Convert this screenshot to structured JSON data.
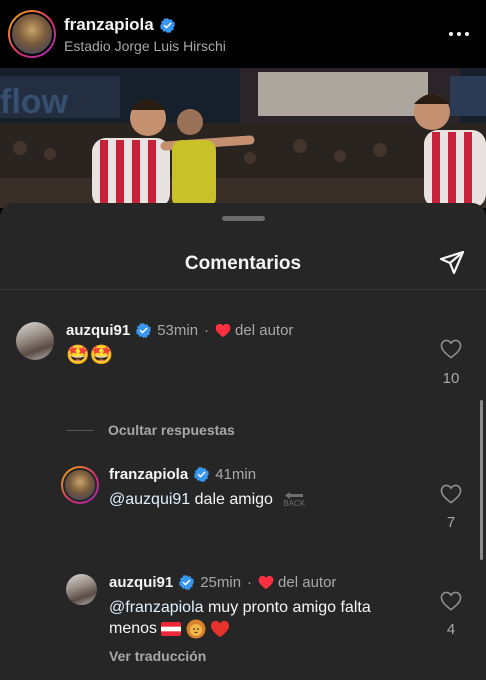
{
  "post": {
    "username": "franzapiola",
    "location": "Estadio Jorge Luis Hirschi"
  },
  "sheet": {
    "title": "Comentarios"
  },
  "comments": [
    {
      "username": "auzqui91",
      "time": "53min",
      "author_like": "del autor",
      "emoji_text": "🤩🤩",
      "likes": "10"
    }
  ],
  "hide_replies": "Ocultar respuestas",
  "replies": [
    {
      "username": "franzapiola",
      "time": "41min",
      "mention": "@auzqui91",
      "text": "dale amigo",
      "likes": "7",
      "back_badge": "BACK"
    },
    {
      "username": "auzqui91",
      "time": "25min",
      "author_like": "del autor",
      "mention": "@franzapiola",
      "text_line1": "muy pronto amigo falta",
      "text_line2": "menos",
      "likes": "4",
      "translate": "Ver traducción"
    }
  ],
  "icons": {
    "verified": "verified-badge-icon",
    "heart_filled": "heart-filled-icon",
    "heart_outline": "heart-outline-icon",
    "share": "paper-plane-icon",
    "more": "more-horizontal-icon"
  },
  "colors": {
    "sheet_bg": "#262626",
    "verified_blue": "#3897f0",
    "author_heart": "#ff3040",
    "muted_text": "#a8a8a8"
  }
}
